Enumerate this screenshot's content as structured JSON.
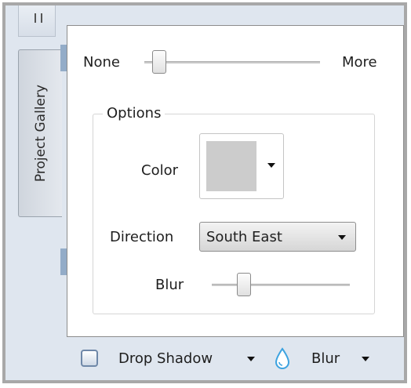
{
  "tabs": {
    "project_gallery": "Project Gallery"
  },
  "intensity": {
    "min_label": "None",
    "max_label": "More",
    "level": 0.05
  },
  "options": {
    "title": "Options",
    "color_label": "Color",
    "color_value": "#cccccc",
    "direction_label": "Direction",
    "direction_value": "South East",
    "blur_label": "Blur",
    "blur_level": 0.2
  },
  "bottom_bar": {
    "drop_shadow_label": "Drop Shadow",
    "blur_label": "Blur"
  },
  "colors": {
    "accent": "#93acc8",
    "blur_icon": "#3da3e0"
  },
  "icons": [
    "chevron-down-icon",
    "water-drop-icon",
    "checkbox-icon"
  ]
}
